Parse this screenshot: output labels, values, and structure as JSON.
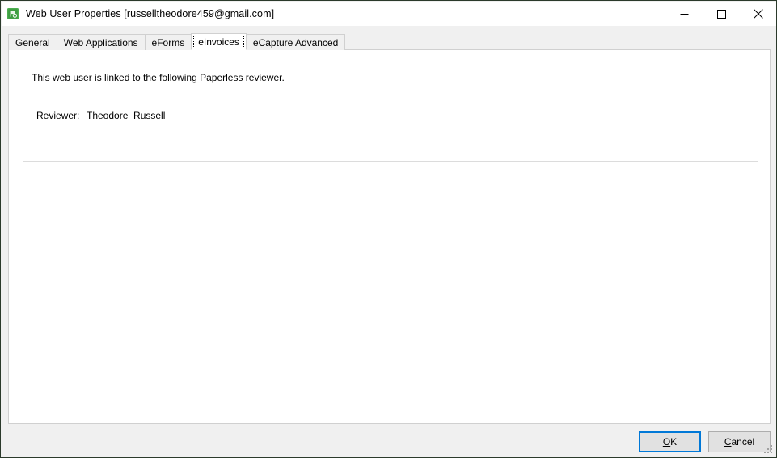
{
  "window": {
    "title": "Web User Properties [russelltheodore459@gmail.com]",
    "icon_name": "app-icon",
    "border_color": "#2b3a2b",
    "background": "#f0f0f0"
  },
  "caption_buttons": [
    {
      "name": "minimize",
      "glyph": "minimize-icon"
    },
    {
      "name": "maximize",
      "glyph": "maximize-icon"
    },
    {
      "name": "close",
      "glyph": "close-icon"
    }
  ],
  "tabs": [
    {
      "label": "General",
      "selected": false
    },
    {
      "label": "Web Applications",
      "selected": false
    },
    {
      "label": "eForms",
      "selected": false
    },
    {
      "label": "eInvoices",
      "selected": true
    },
    {
      "label": "eCapture Advanced",
      "selected": false
    }
  ],
  "panel": {
    "description": "This web user is linked to the following Paperless reviewer.",
    "reviewer_label": "Reviewer:",
    "reviewer_value": "Theodore  Russell"
  },
  "footer": {
    "ok_prefix": "",
    "ok_accel": "O",
    "ok_suffix": "K",
    "cancel_prefix": "",
    "cancel_accel": "C",
    "cancel_suffix": "ancel",
    "default_button_color": "#0078d7"
  }
}
